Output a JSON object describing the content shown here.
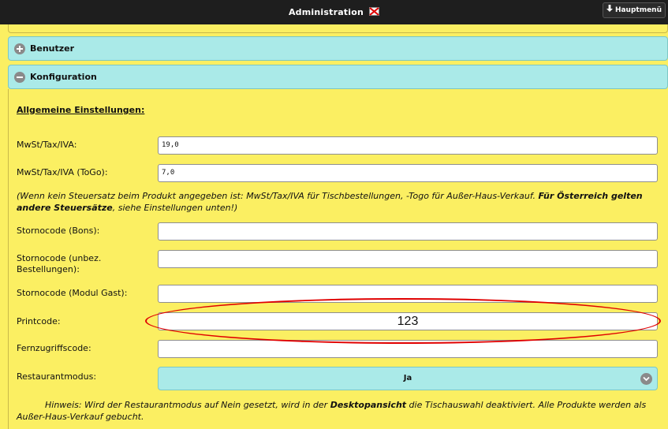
{
  "header": {
    "title": "Administration",
    "menu_label": "Hauptmenü",
    "menu_icon": "arrow-down-icon",
    "title_icon": "broken-image-icon"
  },
  "accordion": {
    "benutzer": {
      "label": "Benutzer",
      "state": "collapsed",
      "icon": "plus-circle-icon"
    },
    "konfiguration": {
      "label": "Konfiguration",
      "state": "expanded",
      "icon": "minus-circle-icon"
    }
  },
  "settings": {
    "section_title": "Allgemeine Einstellungen:",
    "mwst": {
      "label": "MwSt/Tax/IVA:",
      "value": "19,0"
    },
    "mwst_togo": {
      "label": "MwSt/Tax/IVA (ToGo):",
      "value": "7,0"
    },
    "note_part1": "(Wenn kein Steuersatz beim Produkt angegeben ist: MwSt/Tax/IVA für Tischbestellungen, -Togo für Außer-Haus-Verkauf. ",
    "note_bold": "Für Österreich gelten andere Steuersätze",
    "note_part2": ", siehe Einstellungen unten!)",
    "storno_bons": {
      "label": "Stornocode (Bons):",
      "value": ""
    },
    "storno_unbez": {
      "label": "Stornocode (unbez. Bestellungen):",
      "value": ""
    },
    "storno_gast": {
      "label": "Stornocode (Modul Gast):",
      "value": ""
    },
    "printcode": {
      "label": "Printcode:",
      "value": "123"
    },
    "fernzugriff": {
      "label": "Fernzugriffscode:",
      "value": ""
    },
    "restaurantmodus": {
      "label": "Restaurantmodus:",
      "value": "Ja"
    },
    "hint_part1": "Hinweis: Wird der Restaurantmodus auf Nein gesetzt, wird in der ",
    "hint_bold": "Desktopansicht",
    "hint_part2": " die Tischauswahl deaktiviert. Alle Produkte werden als Außer-Haus-Verkauf gebucht."
  },
  "colors": {
    "background": "#fbef62",
    "topbar": "#1e1e1e",
    "accordion_header": "#aaeae8",
    "highlight_ellipse": "#e00000"
  }
}
